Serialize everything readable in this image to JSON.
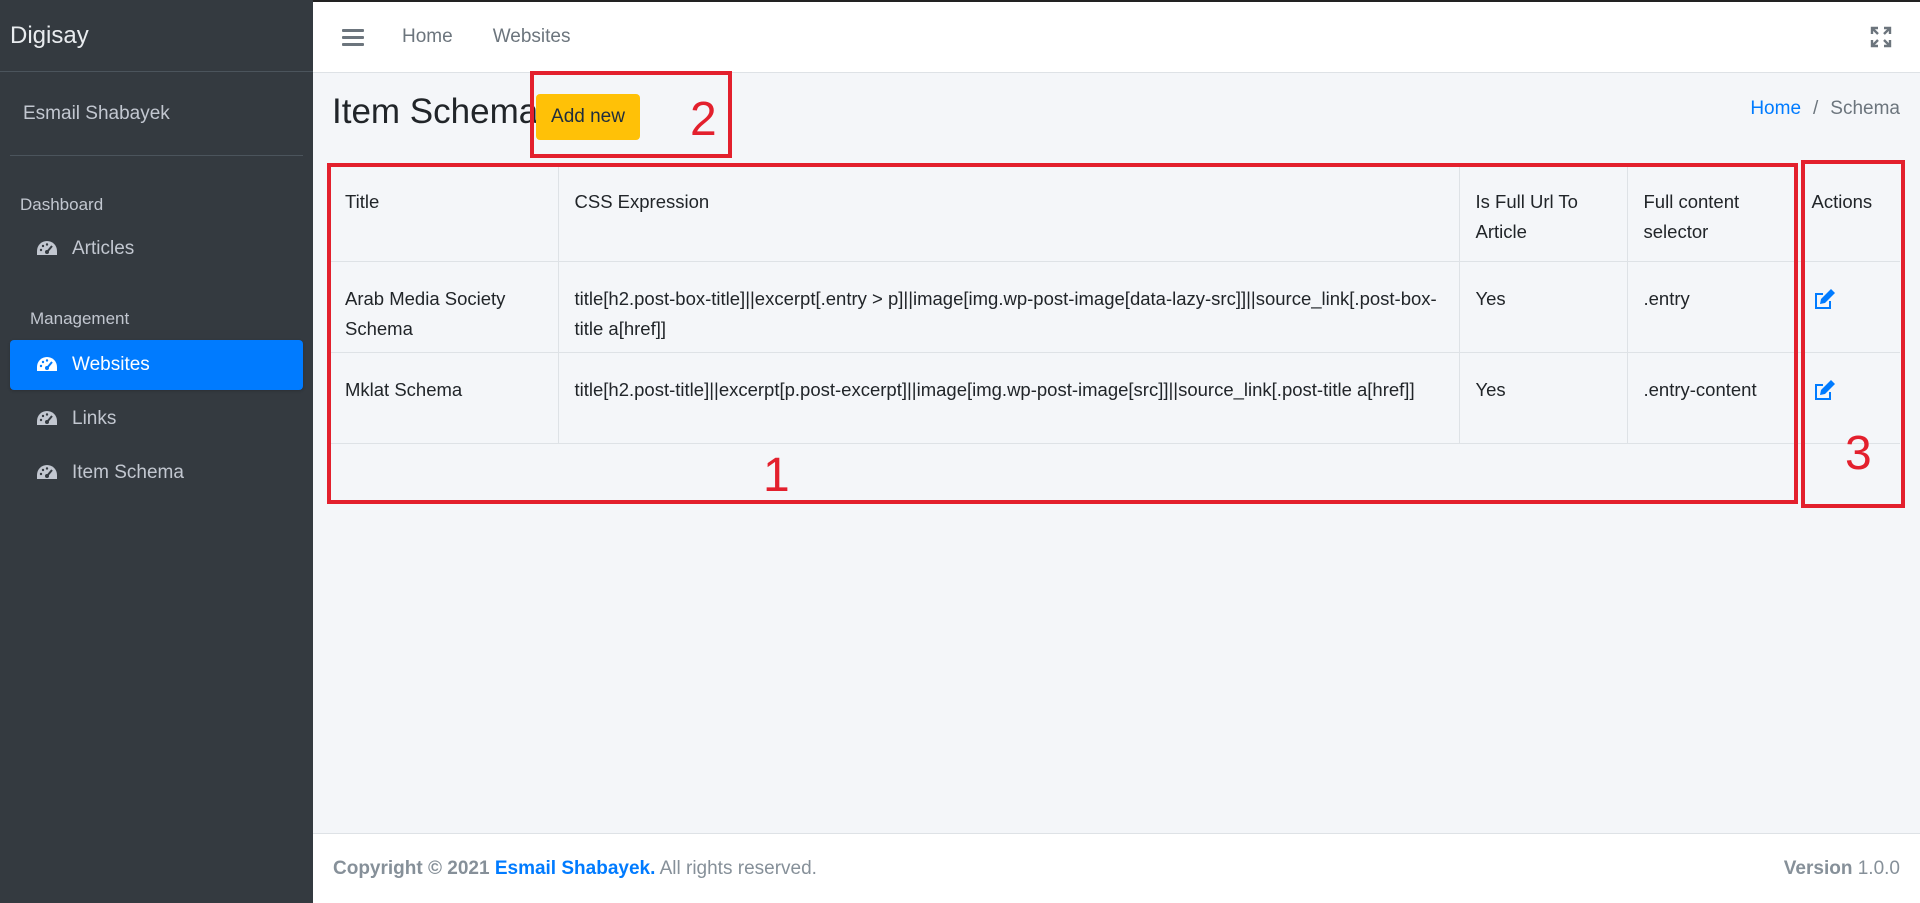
{
  "sidebar": {
    "brand": "Digisay",
    "user": "Esmail Shabayek",
    "header_dashboard": "Dashboard",
    "header_management": "Management",
    "items": [
      {
        "label": "Articles"
      },
      {
        "label": "Websites"
      },
      {
        "label": "Links"
      },
      {
        "label": "Item Schema"
      }
    ]
  },
  "topbar": {
    "links": [
      "Home",
      "Websites"
    ]
  },
  "page": {
    "title": "Item Schema",
    "add_button": "Add new",
    "breadcrumb": {
      "home": "Home",
      "separator": "/",
      "current": "Schema"
    }
  },
  "table": {
    "headers": [
      "Title",
      "CSS Expression",
      "Is Full Url To Article",
      "Full content selector",
      "Actions"
    ],
    "rows": [
      {
        "title": "Arab Media Society Schema",
        "css": "title[h2.post-box-title]||excerpt[.entry > p]||image[img.wp-post-image[data-lazy-src]]||source_link[.post-box-title a[href]]",
        "full_url": "Yes",
        "selector": ".entry"
      },
      {
        "title": "Mklat Schema",
        "css": "title[h2.post-title]||excerpt[p.post-excerpt]||image[img.wp-post-image[src]]||source_link[.post-title a[href]]",
        "full_url": "Yes",
        "selector": ".entry-content"
      }
    ]
  },
  "annotations": [
    "1",
    "2",
    "3"
  ],
  "footer": {
    "copyright": "Copyright © 2021",
    "author": "Esmail Shabayek.",
    "rights": "All rights reserved.",
    "version_label": "Version",
    "version": "1.0.0"
  },
  "colors": {
    "sidebar_bg": "#343a40",
    "active_blue": "#007bff",
    "add_button": "#ffc107",
    "annotation_red": "#e3202d"
  },
  "icons": [
    "hamburger-icon",
    "expand-icon",
    "dashboard-gauge-icon",
    "edit-icon"
  ]
}
